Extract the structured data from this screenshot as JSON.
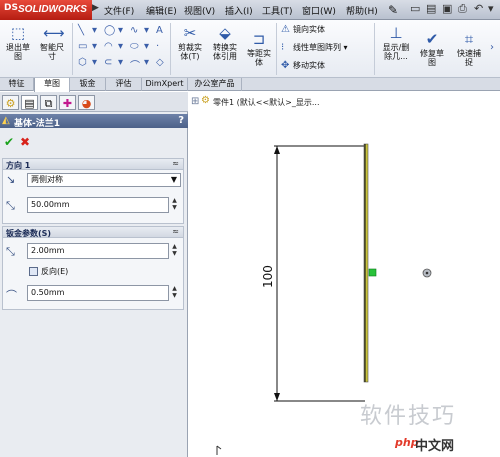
{
  "app": {
    "brand_prefix": "DS",
    "brand_name": "SOLIDWORKS"
  },
  "menu": {
    "items": [
      "文件(F)",
      "编辑(E)",
      "视图(V)",
      "插入(I)",
      "工具(T)",
      "窗口(W)",
      "帮助(H)"
    ]
  },
  "ribbon": {
    "exit_sketch": "退出草\n图",
    "smart_dimension": "智能尺\n寸",
    "trim_entities": "剪裁实\n体(T)",
    "convert_entities": "转换实\n体引用",
    "offset_entities": "等距实\n体",
    "mirror_entities": "镜向实体",
    "linear_pattern": "线性草图阵列",
    "move_entities": "移动实体",
    "display_relations": "显示/删\n除几...",
    "repair_sketch": "修复草\n图",
    "quick_snaps": "快速捕\n捉"
  },
  "tabs": [
    "特征",
    "草图",
    "钣金",
    "评估",
    "DimXpert",
    "办公室产品"
  ],
  "panel": {
    "title": "基体-法兰1",
    "help": "?",
    "direction_group": {
      "title": "方向 1",
      "end_condition": "两侧对称",
      "depth": "50.00mm"
    },
    "sheetmetal_group": {
      "title": "钣金参数(S)",
      "thickness": "2.00mm",
      "reverse_label": "反向(E)",
      "bend_radius": "0.50mm"
    }
  },
  "graphics": {
    "tree_text": "零件1 (默认<<默认>_显示...",
    "dimension_value": "100",
    "watermark": "软件技巧",
    "site_prefix": "php",
    "site_name": "中文网"
  }
}
